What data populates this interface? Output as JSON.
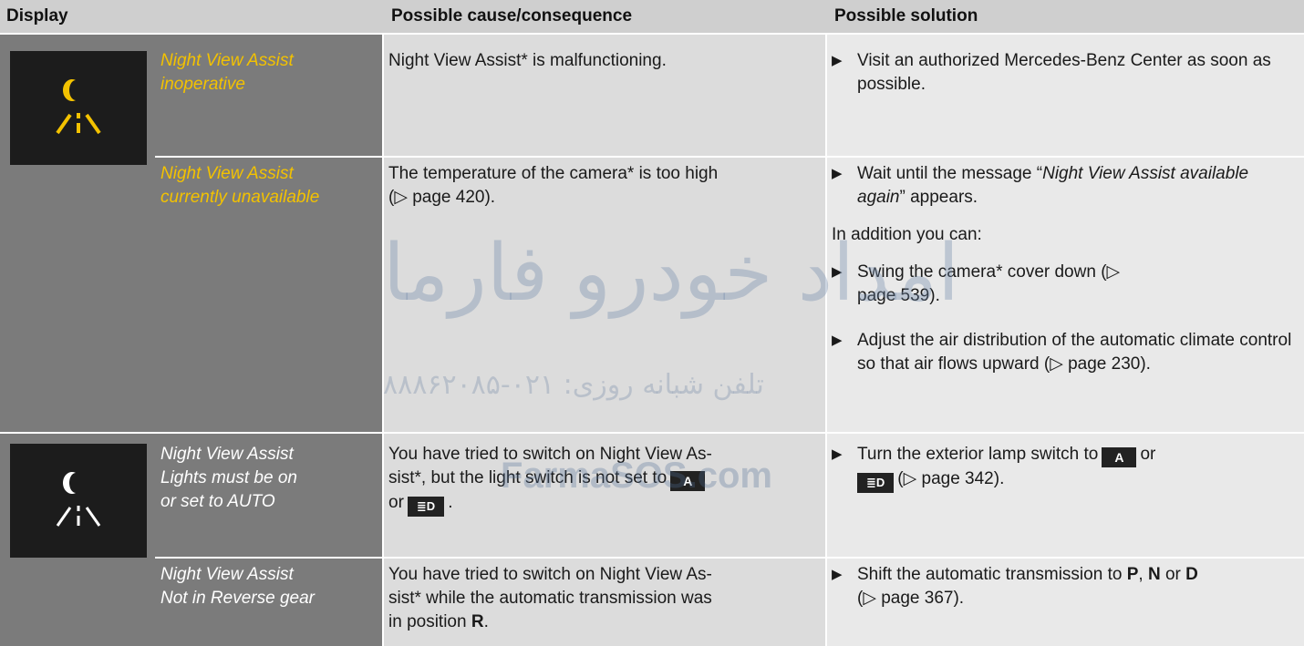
{
  "header": {
    "display": "Display",
    "cause": "Possible cause/consequence",
    "solution": "Possible solution"
  },
  "colors": {
    "highlight": "#f3c200",
    "display_bg": "#7b7b7b",
    "icon_bg": "#1c1c1c"
  },
  "rows": [
    {
      "icon": "night-view-icon",
      "message_l1": "Night View Assist",
      "message_l2": "inoperative",
      "cause": "Night View Assist* is malfunctioning.",
      "solution_1": "Visit an authorized Mercedes-Benz Center as soon as possible."
    },
    {
      "message_l1": "Night View Assist",
      "message_l2": "currently unavailable",
      "cause_a": "The temperature of the camera* is too high",
      "cause_b": "(▷ page 420).",
      "sol_wait_a": "Wait until the message “",
      "sol_wait_italic": "Night View Assist available again",
      "sol_wait_b": "” appears.",
      "sol_addition": "In addition you can:",
      "sol_swing": "Swing the camera* cover down (▷ page 539).",
      "sol_adjust": "Adjust the air distribution of the automatic climate control so that air flows upward (▷ page 230)."
    },
    {
      "icon": "night-view-icon",
      "message_l1": "Night View Assist",
      "message_l2": "Lights must be on",
      "message_l3": "or set to AUTO",
      "cause_a": "You have tried to switch on Night View As-",
      "cause_b": "sist*, but the light switch is not set to",
      "cause_c": "or",
      "key_auto": "A",
      "key_lamp": "≣D",
      "sol_a": "Turn the exterior lamp switch to",
      "sol_or": "or",
      "sol_b": "(▷ page 342)."
    },
    {
      "message_l1": "Night View Assist",
      "message_l2": "Not in Reverse gear",
      "cause_a": "You have tried to switch on Night View As-",
      "cause_b": "sist* while the automatic transmission was",
      "cause_c": "in position",
      "cause_gear": "R",
      "sol_a": "Shift the automatic transmission to",
      "gear_p": "P",
      "gear_n": "N",
      "gear_d": "D",
      "sol_or": "or",
      "sol_b": "(▷ page 367)."
    }
  ],
  "watermark": {
    "arabic": "امداد خودرو فارما",
    "phone": "تلفن شبانه روزی: ۰۲۱-۸۸۸۶۲۰۸۵",
    "site": "FarmaSOS.com"
  }
}
